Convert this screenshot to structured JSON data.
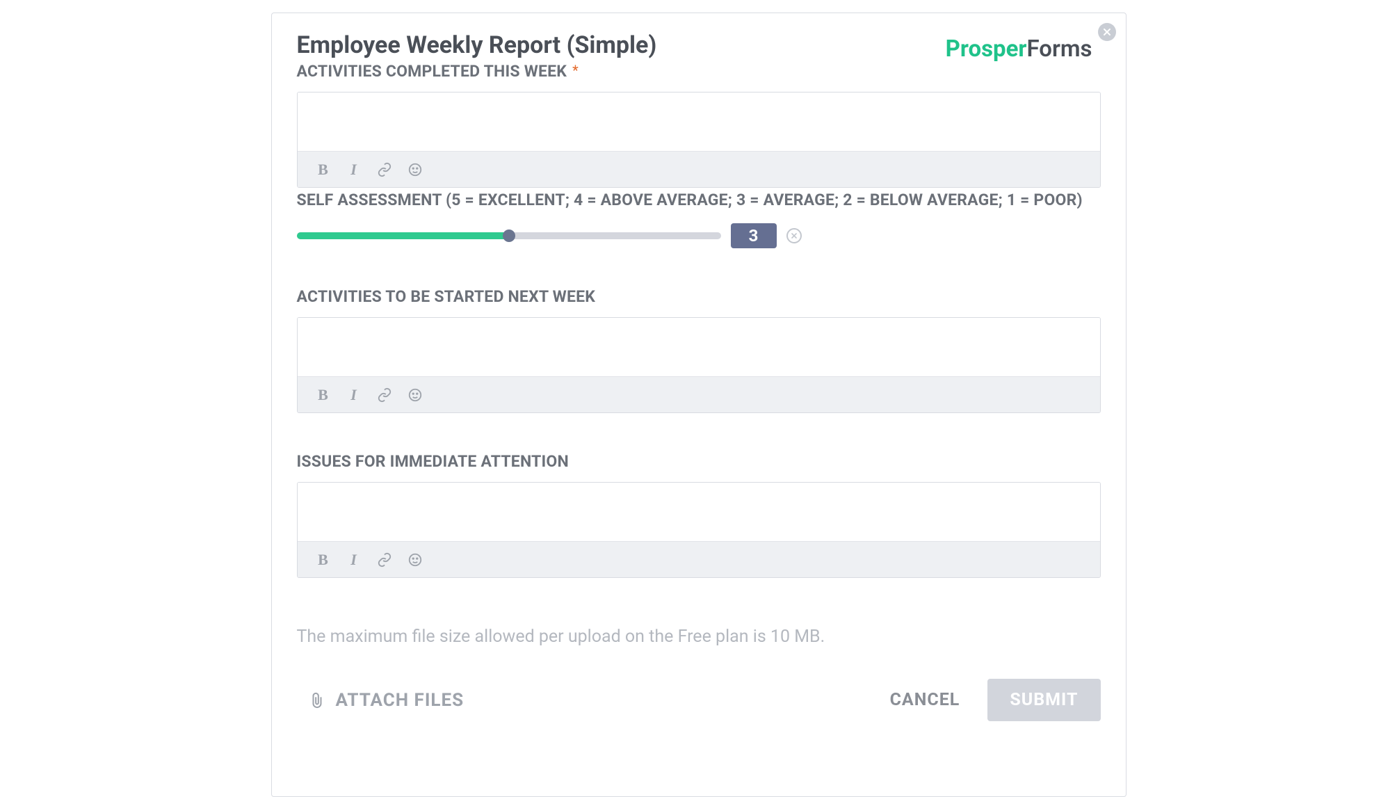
{
  "brand": {
    "part1": "Prosper",
    "part2": "Forms"
  },
  "form": {
    "title": "Employee Weekly Report (Simple)",
    "fields": {
      "activities_completed": {
        "label": "ACTIVITIES COMPLETED THIS WEEK",
        "required_mark": "*",
        "value": ""
      },
      "self_assessment": {
        "label": "SELF ASSESSMENT (5 = EXCELLENT; 4 = ABOVE AVERAGE; 3 = AVERAGE; 2 = BELOW AVERAGE; 1 = POOR)",
        "value": 3,
        "min": 1,
        "max": 5,
        "display": "3",
        "fill_percent": 50
      },
      "activities_next": {
        "label": "ACTIVITIES TO BE STARTED NEXT WEEK",
        "value": ""
      },
      "issues": {
        "label": "ISSUES FOR IMMEDIATE ATTENTION",
        "value": ""
      }
    },
    "file_note": "The maximum file size allowed per upload on the Free plan is 10 MB.",
    "attach_label": "ATTACH FILES",
    "cancel_label": "CANCEL",
    "submit_label": "SUBMIT"
  },
  "toolbar": {
    "bold": "B",
    "italic": "I"
  },
  "icons": {
    "close": "close-icon",
    "link": "link-icon",
    "emoji": "emoji-icon",
    "paperclip": "paperclip-icon",
    "clear": "clear-icon"
  }
}
